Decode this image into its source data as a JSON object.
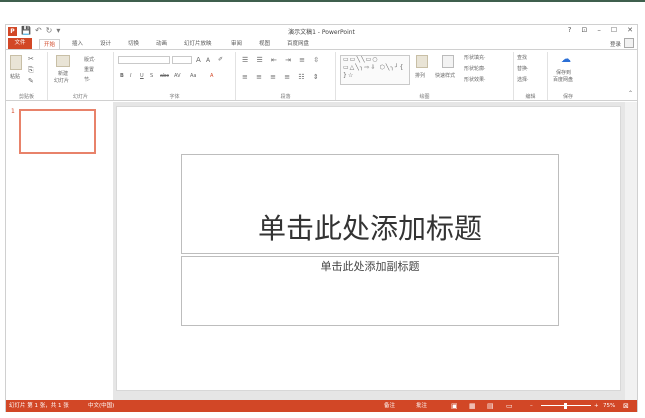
{
  "app": {
    "title": "演示文稿1 - PowerPoint"
  },
  "qat": {
    "logo": "P",
    "save": "💾",
    "undo": "↶",
    "redo": "↻",
    "more": "▾"
  },
  "window_controls": {
    "help": "?",
    "restore_ribbon": "⊡",
    "minimize": "–",
    "maximize": "☐",
    "close": "✕"
  },
  "account": {
    "login": "登录"
  },
  "tabs": [
    "文件",
    "开始",
    "插入",
    "设计",
    "切换",
    "动画",
    "幻灯片放映",
    "审阅",
    "视图",
    "百度网盘"
  ],
  "ribbon": {
    "clipboard": {
      "paste": "粘贴",
      "label": "剪贴板"
    },
    "slides": {
      "new_slide": "新建",
      "new_slide2": "幻灯片",
      "layout": "版式·",
      "reset": "重置",
      "section": "节·",
      "label": "幻灯片"
    },
    "font": {
      "bold": "B",
      "italic": "I",
      "underline": "U",
      "strike": "S",
      "shadow": "abc",
      "spacing": "AV",
      "case": "Aa",
      "color": "A",
      "grow": "A",
      "shrink": "A",
      "clear": "✐",
      "label": "字体"
    },
    "paragraph": {
      "label": "段落"
    },
    "drawing": {
      "arrange": "排列",
      "quick_styles": "快速样式",
      "fill": "形状填充·",
      "outline": "形状轮廓·",
      "effects": "形状效果·",
      "label": "绘图",
      "shapes": "▭▭╲╲▭○ ▭△╲╮⇨⇩ ⬡╲╮╯{ }☆"
    },
    "editing": {
      "find": "查找",
      "replace": "替换·",
      "select": "选择·",
      "label": "编辑"
    },
    "save": {
      "btn1": "保存到",
      "btn2": "百度网盘",
      "label": "保存"
    }
  },
  "thumbnail": {
    "number": "1"
  },
  "slide": {
    "title": "单击此处添加标题",
    "subtitle": "单击此处添加副标题"
  },
  "statusbar": {
    "slide_info": "幻灯片 第 1 张，共 1 张",
    "language": "中文(中国)",
    "notes": "备注",
    "comments": "批注",
    "zoom": "75%"
  },
  "colors": {
    "accent": "#d24726"
  }
}
